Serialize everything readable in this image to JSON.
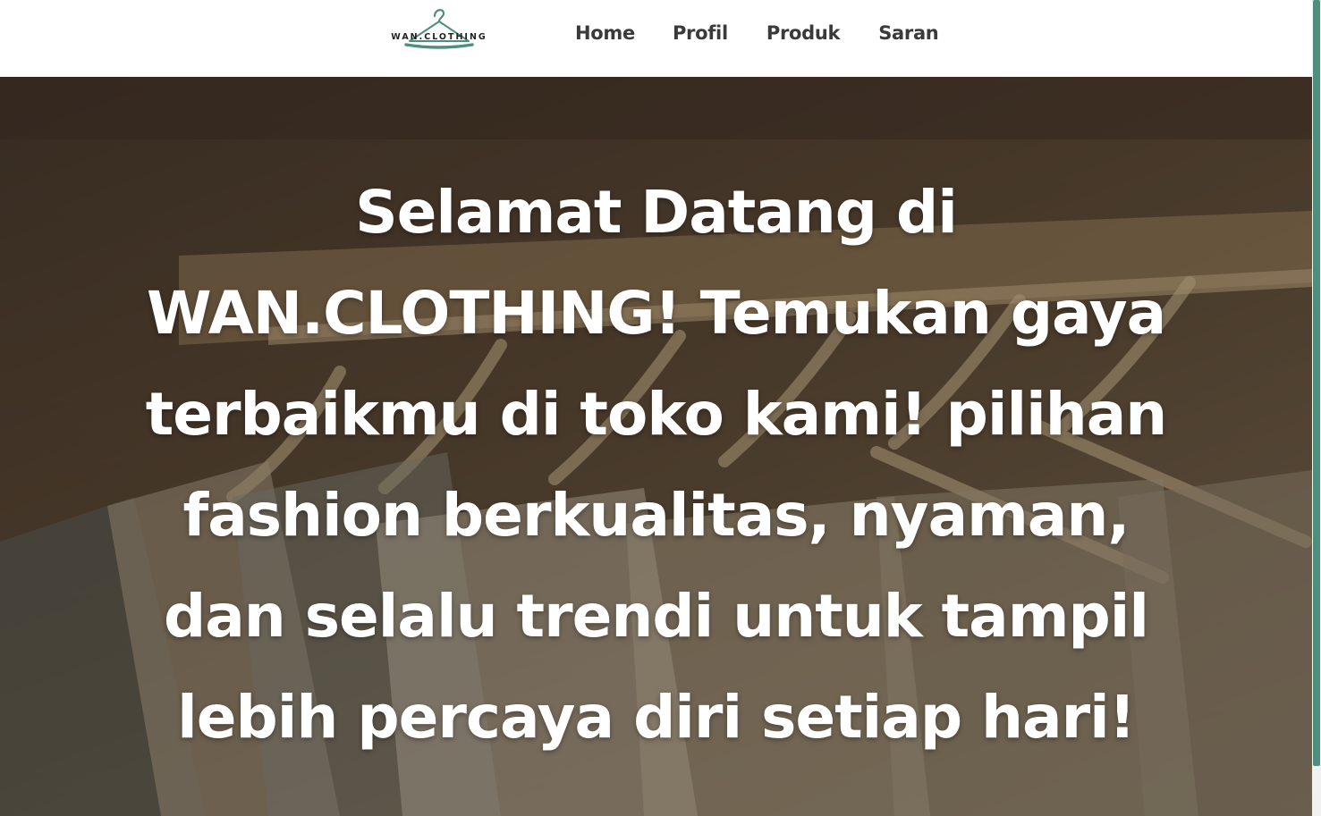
{
  "brand": {
    "logo_text": "WAN.CLOTHING",
    "hanger_color": "#4e8e80"
  },
  "nav": {
    "items": [
      {
        "label": "Home"
      },
      {
        "label": "Profil"
      },
      {
        "label": "Produk"
      },
      {
        "label": "Saran"
      }
    ]
  },
  "hero": {
    "heading": "Selamat Datang di WAN.CLOTHING! Temukan gaya terbaikmu di toko kami! pilihan fashion berkualitas, nyaman, dan selalu trendi untuk tampil lebih percaya diri setiap hari!"
  },
  "colors": {
    "accent": "#4e8e80",
    "nav_text": "#3a3a3a",
    "hero_text": "#ffffff"
  }
}
